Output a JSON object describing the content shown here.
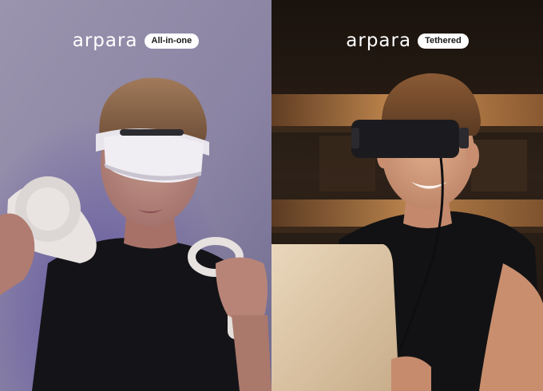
{
  "panels": [
    {
      "brand": "arpara",
      "badge": "All-in-one",
      "scene": "person-white-headset-with-controllers",
      "colors": {
        "background": "#8e88a6",
        "headset": "#f0eef2",
        "shirt": "#141418"
      }
    },
    {
      "brand": "arpara",
      "badge": "Tethered",
      "scene": "person-black-headset-with-laptop",
      "colors": {
        "background": "#2a1f18",
        "shelf_light": "#e6a25c",
        "headset": "#1b1b1f",
        "laptop": "#d9c3a3"
      }
    }
  ]
}
